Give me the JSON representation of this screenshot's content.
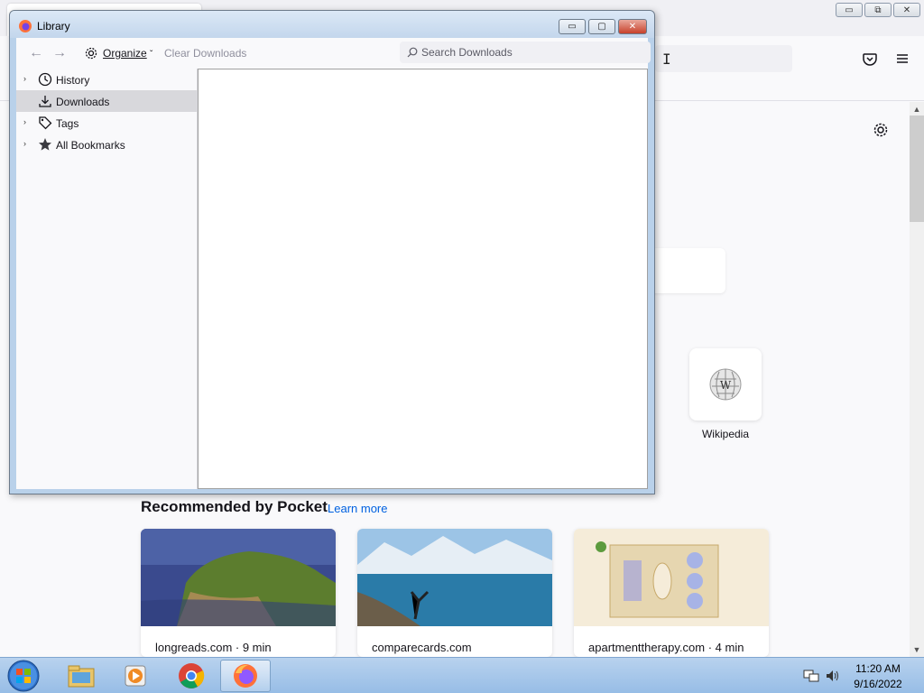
{
  "browser": {
    "toolbar": {
      "pocket_icon": "pocket-icon",
      "menu_icon": "hamburger-menu-icon"
    },
    "newtab": {
      "settings_icon": "gear-icon",
      "top_sites": [
        {
          "label": "Wikipedia",
          "icon": "wikipedia-globe-icon"
        }
      ],
      "pocket": {
        "heading": "Recommended by Pocket",
        "learn_more": "Learn more",
        "cards": [
          {
            "source": "longreads.com · 9 min"
          },
          {
            "source": "comparecards.com"
          },
          {
            "source": "apartmenttherapy.com · 4 min"
          }
        ]
      }
    },
    "window_controls": {
      "minimize": "▭",
      "restore": "⧉",
      "close": "✕"
    }
  },
  "library": {
    "title": "Library",
    "toolbar": {
      "back_icon": "←",
      "forward_icon": "→",
      "organize_label": "Organize",
      "organize_caret": "ˇ",
      "clear_label": "Clear Downloads",
      "search_placeholder": "Search Downloads"
    },
    "tree": [
      {
        "label": "History",
        "icon": "clock-icon",
        "twisty": "›",
        "selected": false
      },
      {
        "label": "Downloads",
        "icon": "download-icon",
        "twisty": "",
        "selected": true
      },
      {
        "label": "Tags",
        "icon": "tag-icon",
        "twisty": "›",
        "selected": false
      },
      {
        "label": "All Bookmarks",
        "icon": "star-icon",
        "twisty": "›",
        "selected": false
      }
    ],
    "window_controls": {
      "minimize": "▭",
      "maximize": "▢",
      "close": "✕"
    }
  },
  "taskbar": {
    "apps": [
      "windows-explorer-icon",
      "media-player-icon",
      "chrome-icon",
      "firefox-icon"
    ],
    "clock": {
      "time": "11:20 AM",
      "date": "9/16/2022"
    }
  }
}
